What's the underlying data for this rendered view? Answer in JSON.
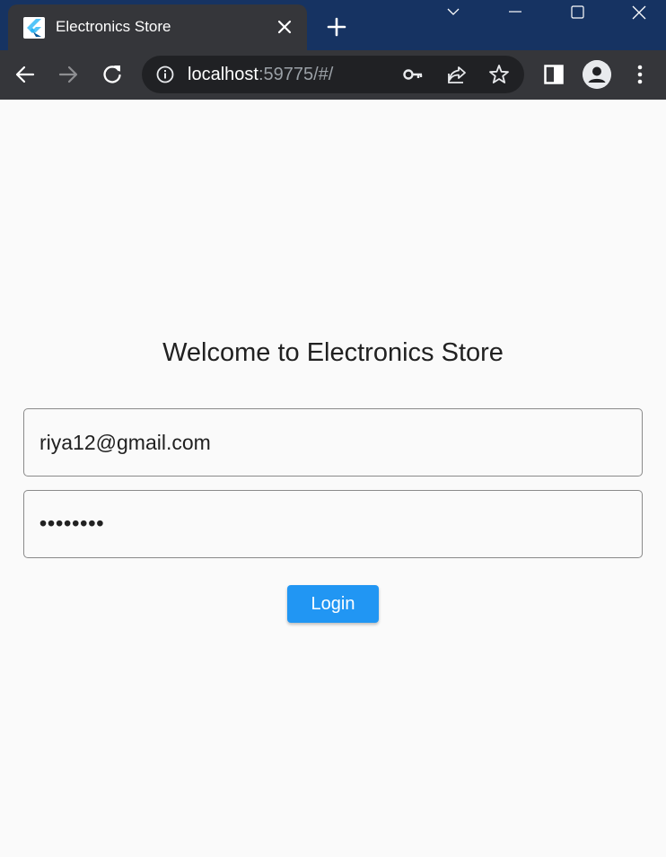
{
  "browser": {
    "tab": {
      "title": "Electronics Store",
      "favicon": "flutter-logo"
    },
    "address_bar": {
      "host": "localhost",
      "rest": ":59775/#/"
    },
    "colors": {
      "titlebar": "#163362",
      "tab": "#35363a",
      "omnibox": "#202124"
    }
  },
  "page": {
    "heading": "Welcome to Electronics Store",
    "email_field": {
      "value": "riya12@gmail.com"
    },
    "password_field": {
      "value": "••••••••"
    },
    "login_button": {
      "label": "Login",
      "color": "#2196f3"
    }
  }
}
